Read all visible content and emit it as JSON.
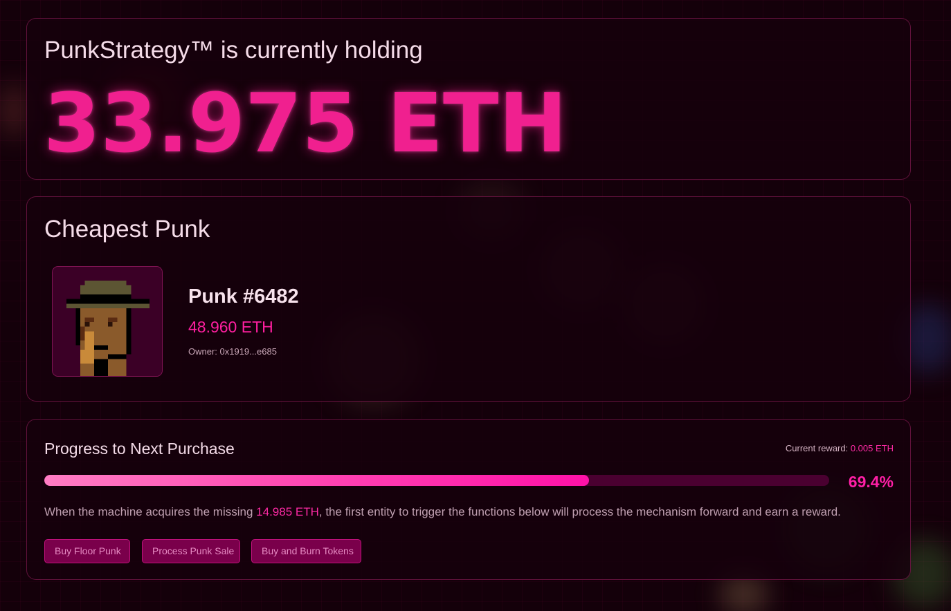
{
  "holding": {
    "title": "PunkStrategy™ is currently holding",
    "amount": "33.975 ETH"
  },
  "cheapest": {
    "title": "Cheapest Punk",
    "punk_name": "Punk #6482",
    "punk_price": "48.960 ETH",
    "owner": "Owner: 0x1919...e685"
  },
  "progress": {
    "title": "Progress to Next Purchase",
    "reward_label": "Current reward:",
    "reward_value": "0.005 ETH",
    "percent_label": "69.4%",
    "percent_value": 69.4,
    "description_prefix": "When the machine acquires the missing ",
    "description_amount": "14.985 ETH",
    "description_suffix": ", the first entity to trigger the functions below will process the mechanism forward and earn a reward.",
    "buttons": [
      {
        "label": "Buy Floor Punk"
      },
      {
        "label": "Process Punk Sale"
      },
      {
        "label": "Buy and Burn Tokens"
      }
    ]
  },
  "colors": {
    "accent": "#ff1fa6",
    "background": "#14000a",
    "card_border": "#be2878"
  }
}
